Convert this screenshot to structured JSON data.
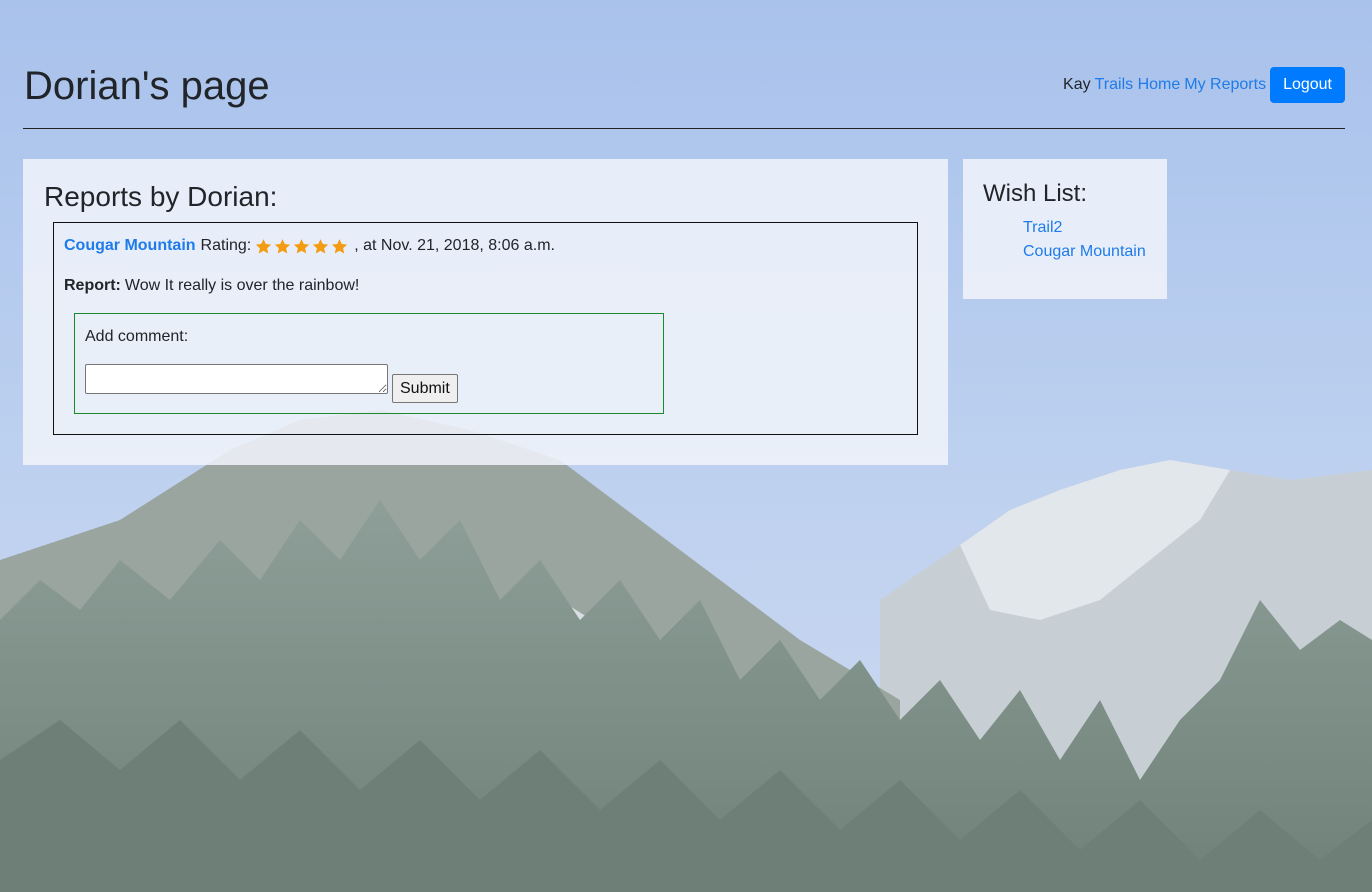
{
  "header": {
    "title": "Dorian's page",
    "nav": {
      "user": "Kay",
      "links": [
        "Trails Home",
        "My Reports"
      ],
      "logout_label": "Logout"
    }
  },
  "reports": {
    "heading": "Reports by Dorian:",
    "items": [
      {
        "trail": "Cougar Mountain",
        "rating_label": "Rating:",
        "rating": 5,
        "rating_max": 5,
        "timestamp": ", at Nov. 21, 2018, 8:06 a.m.",
        "report_label": "Report:",
        "report_text": "Wow It really is over the rainbow!",
        "comment": {
          "label": "Add comment:",
          "value": "",
          "submit_label": "Submit"
        }
      }
    ]
  },
  "wish_list": {
    "heading": "Wish List:",
    "items": [
      "Trail2",
      "Cougar Mountain"
    ]
  },
  "colors": {
    "link": "#1e7be9",
    "primary_button": "#007bff",
    "star": "#f39c12",
    "comment_border": "#1a8a2a"
  },
  "background": {
    "icon": "mountain-forest-photo"
  }
}
